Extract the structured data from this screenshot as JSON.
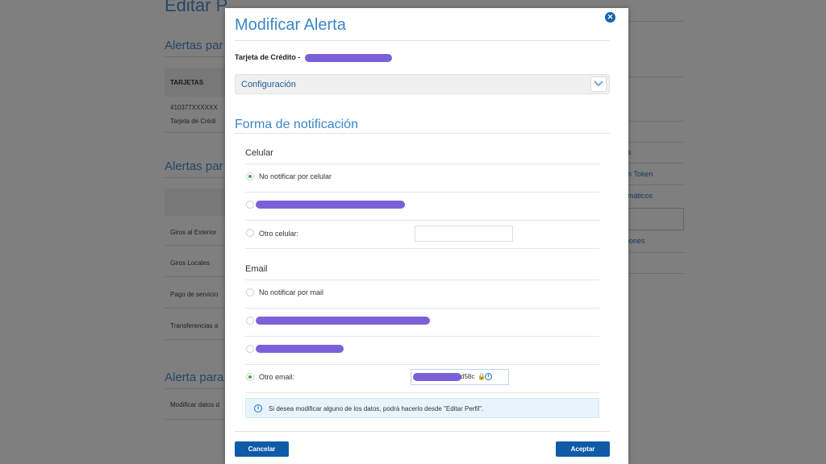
{
  "background": {
    "title": "Editar P",
    "section1": "Alertas par",
    "table_header": "TARJETAS",
    "card_number": "410377XXXXXX",
    "card_type": "Tarjeta de Crédi",
    "section2": "Alertas par",
    "rows": [
      "Giros al Exterior",
      "Giros Locales",
      "Pago de servicio",
      "Transferencias a"
    ],
    "section3": "Alerta para",
    "modify_row": "Modificar datos d",
    "right_links": [
      "s",
      "n Token",
      "máticos",
      "iones"
    ]
  },
  "modal": {
    "title": "Modificar Alerta",
    "close_icon": "close-icon",
    "card_label": "Tarjeta de Crédito -",
    "config_label": "Configuración",
    "section_title": "Forma de notificación",
    "celular": {
      "label": "Celular",
      "options": [
        {
          "label": "No notificar por celular",
          "checked": true
        },
        {
          "label": "",
          "checked": false,
          "redacted": true
        },
        {
          "label": "Otro celular:",
          "checked": false
        }
      ],
      "other_value": ""
    },
    "email": {
      "label": "Email",
      "options": [
        {
          "label": "No notificar por mail",
          "checked": false
        },
        {
          "label": "",
          "checked": false,
          "redacted": true
        },
        {
          "label": "",
          "checked": false,
          "redacted": true
        },
        {
          "label": "Otro email:",
          "checked": true
        }
      ],
      "other_value_suffix": "d58c"
    },
    "info_text": "Si desea modificar alguno de los datos, podrá hacerlo desde \"Editar Perfil\".",
    "cancel_label": "Cancelar",
    "accept_label": "Aceptar"
  },
  "colors": {
    "accent": "#3a86c8",
    "button": "#0f5ba8",
    "redaction": "#7b61d9",
    "radio_checked": "#3cae3c"
  }
}
